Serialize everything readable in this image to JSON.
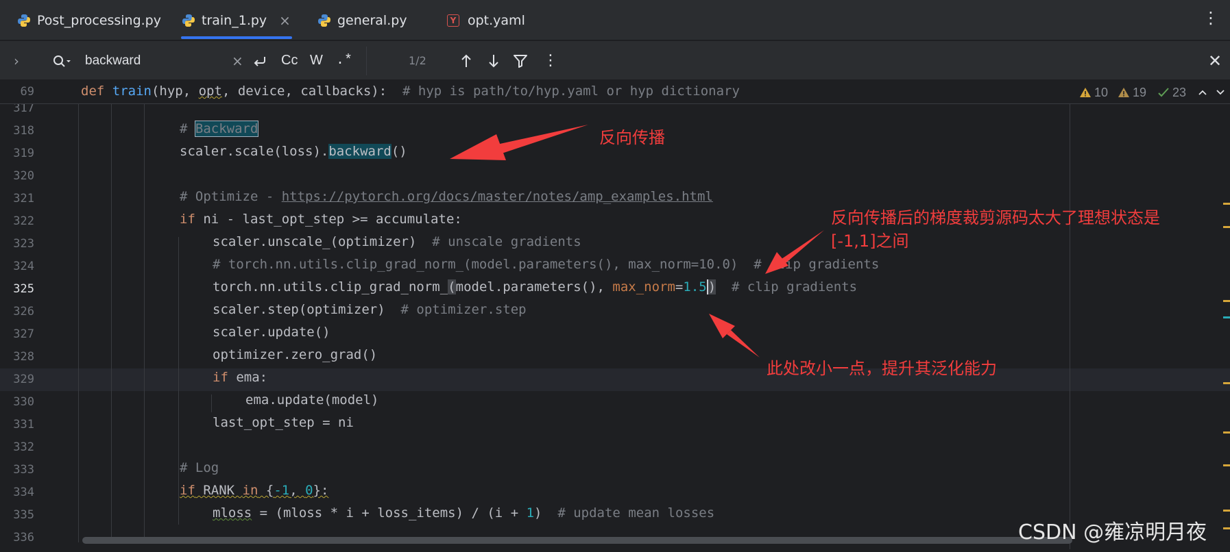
{
  "tabs": [
    {
      "label": "Post_processing.py",
      "icon": "python-icon"
    },
    {
      "label": "train_1.py",
      "icon": "python-icon",
      "active": true,
      "close": "×"
    },
    {
      "label": "general.py",
      "icon": "python-icon"
    },
    {
      "label": "opt.yaml",
      "icon": "yaml-icon",
      "icon_letter": "Y"
    }
  ],
  "find": {
    "query": "backward",
    "match_case": "Cc",
    "words": "W",
    "regex": ".*",
    "count": "1/2"
  },
  "inspections": {
    "warnings_a": "10",
    "warnings_b": "19",
    "ok": "23"
  },
  "sticky": {
    "line_number": "69",
    "code": {
      "kw": "def ",
      "fn": "train",
      "open": "(hyp, ",
      "opt": "opt",
      "rest": ", device, callbacks):",
      "comment": "  # hyp is path/to/hyp.yaml or hyp dictionary"
    }
  },
  "lines": [
    {
      "n": "317"
    },
    {
      "n": "318",
      "comment_prefix": "# ",
      "comment_match": "Backward"
    },
    {
      "n": "319",
      "pre": "scaler.scale(loss).",
      "match": "backward",
      "post": "()"
    },
    {
      "n": "320"
    },
    {
      "n": "321",
      "comment_prefix": "# Optimize - ",
      "url": "https://pytorch.org/docs/master/notes/amp_examples.html"
    },
    {
      "n": "322",
      "kw": "if",
      "rest": " ni - last_opt_step >= accumulate:"
    },
    {
      "n": "323",
      "code": "scaler.unscale_(optimizer)",
      "comment": "  # unscale gradients"
    },
    {
      "n": "324",
      "comment": "# torch.nn.utils.clip_grad_norm_(model.parameters(), max_norm=10.0)  # clip gradients"
    },
    {
      "n": "325",
      "pre": "torch.nn.utils.clip_grad_norm_",
      "paren": "(",
      "mid": "model.parameters(), ",
      "param": "max_norm",
      "eq": "=",
      "num": "1.5",
      "close": ")",
      "comment": "  # clip gradients"
    },
    {
      "n": "326",
      "code": "scaler.step(optimizer)",
      "comment": "  # optimizer.step"
    },
    {
      "n": "327",
      "code": "scaler.update()"
    },
    {
      "n": "328",
      "code": "optimizer.zero_grad()"
    },
    {
      "n": "329",
      "kw": "if",
      "rest": " ema:"
    },
    {
      "n": "330",
      "code": "ema.update(model)"
    },
    {
      "n": "331",
      "code": "last_opt_step = ni"
    },
    {
      "n": "332"
    },
    {
      "n": "333",
      "comment": "# Log"
    },
    {
      "n": "334",
      "kw": "if",
      "a": " RANK ",
      "kw2": "in",
      "b": " {",
      "n1": "-1",
      "c": ", ",
      "n2": "0",
      "d": "}:"
    },
    {
      "n": "335",
      "var": "mloss",
      "rest": " = (mloss * i + loss_items) / (i + ",
      "num": "1",
      "close": ")",
      "comment": "  # update mean losses"
    },
    {
      "n": "336"
    }
  ],
  "annotations": {
    "backward": "反向传播",
    "clip_line1": "反向传播后的梯度裁剪源码太大了理想状态是",
    "clip_line2": "[-1,1]之间",
    "reduce": "此处改小一点，提升其泛化能力"
  },
  "colors": {
    "annotation": "#f23d3d",
    "accent": "#3574f0"
  },
  "watermark": "CSDN @雍凉明月夜"
}
